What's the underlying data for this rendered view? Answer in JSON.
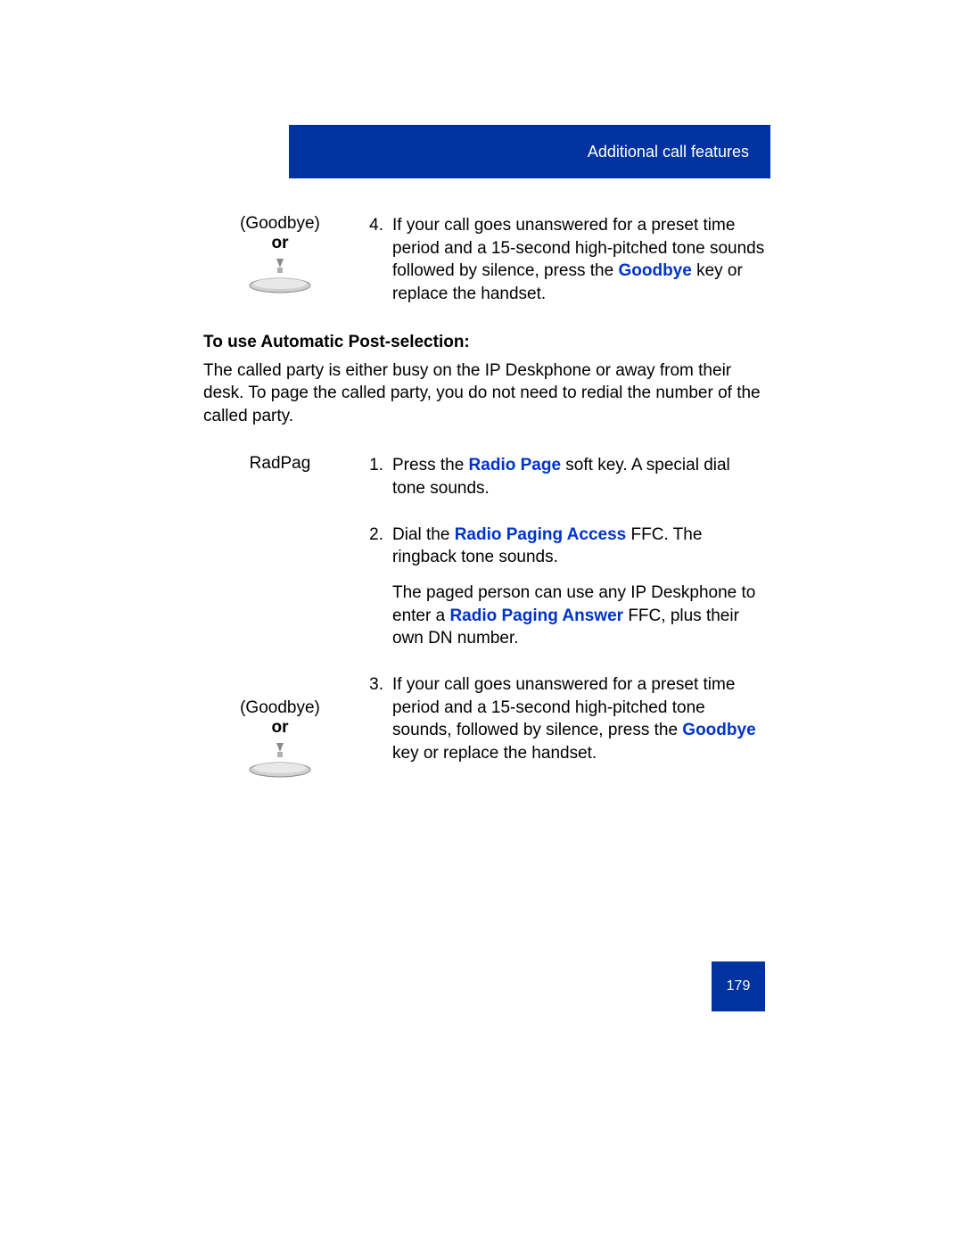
{
  "header": {
    "title": "Additional call features"
  },
  "step4": {
    "left": {
      "goodbye": "(Goodbye)",
      "or": "or"
    },
    "num": "4.",
    "text_a": "If your call goes unanswered for a preset time period and a 15-second high-pitched tone sounds followed by silence, press the ",
    "text_key": "Goodbye",
    "text_b": " key or replace the handset."
  },
  "section": {
    "heading": "To use Automatic Post-selection:",
    "intro": "The called party is either busy on the IP Deskphone or away from their desk. To page the called party, you do not need to redial the number of the called party."
  },
  "step1": {
    "left": "RadPag",
    "num": "1.",
    "text_a": "Press the ",
    "text_key": "Radio Page",
    "text_b": " soft key. A special dial tone sounds."
  },
  "step2": {
    "num": "2.",
    "p1_a": "Dial the ",
    "p1_key": "Radio Paging Access",
    "p1_b": " FFC. The ringback tone sounds.",
    "p2_a": "The paged person can use any IP Deskphone to enter a ",
    "p2_key": "Radio Paging Answer",
    "p2_b": " FFC, plus their own DN number."
  },
  "step3": {
    "left": {
      "goodbye": "(Goodbye)",
      "or": "or"
    },
    "num": "3.",
    "text_a": "If your call goes unanswered for a preset time period and a 15-second high-pitched tone sounds, followed by silence, press the ",
    "text_key": "Goodbye",
    "text_b": " key or replace the handset."
  },
  "page_number": "179"
}
